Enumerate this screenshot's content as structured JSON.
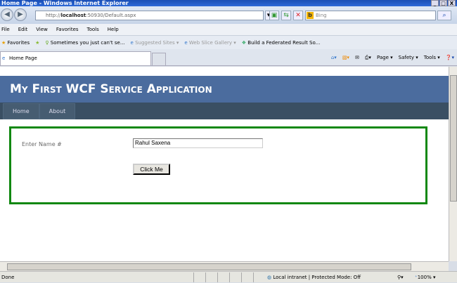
{
  "window": {
    "title": "Home Page - Windows Internet Explorer"
  },
  "address": {
    "prefix": "http://",
    "host": "localhost",
    "rest": ":50930/Default.aspx"
  },
  "search": {
    "placeholder": "Bing"
  },
  "menu": [
    "File",
    "Edit",
    "View",
    "Favorites",
    "Tools",
    "Help"
  ],
  "favorites": {
    "label": "Favorites",
    "items": [
      "Sometimes you just can't se...",
      "Suggested Sites ▾",
      "Web Slice Gallery ▾",
      "Build a Federated Result So..."
    ]
  },
  "tab": {
    "label": "Home Page"
  },
  "commands": [
    "Page ▾",
    "Safety ▾",
    "Tools ▾"
  ],
  "page": {
    "title": "My First WCF Service Application",
    "nav": [
      "Home",
      "About"
    ],
    "label": "Enter Name #",
    "input_value": "Rahul Saxena",
    "button": "Click Me"
  },
  "status": {
    "text": "Done",
    "zone": "Local intranet | Protected Mode: Off",
    "zoom": "100%"
  }
}
